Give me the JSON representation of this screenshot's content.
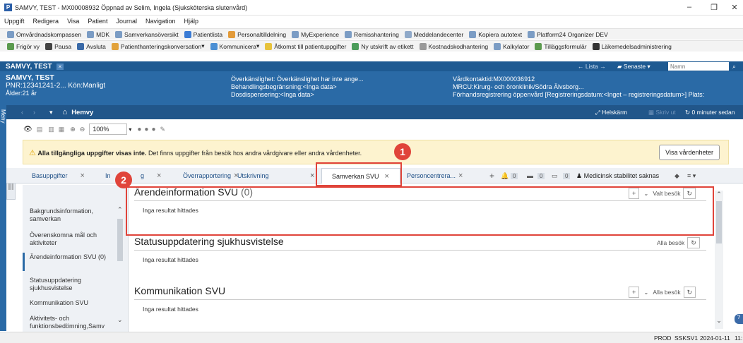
{
  "window": {
    "title": "SAMVY, TEST - MX00008932 Öppnad av Selim, Ingela (Sjuksköterska slutenvård)",
    "app_icon": "P"
  },
  "menu": [
    "Uppgift",
    "Redigera",
    "Visa",
    "Patient",
    "Journal",
    "Navigation",
    "Hjälp"
  ],
  "toolbar1": [
    "Omvårdnadskompassen",
    "MDK",
    "Samverkansöversikt",
    "Patientlista",
    "Personaltilldelning",
    "MyExperience",
    "Remisshantering",
    "Meddelandecenter",
    "Kopiera autotext",
    "Platform24 Organizer DEV"
  ],
  "toolbar2": [
    "Frigör vy",
    "Pausa",
    "Avsluta",
    "Patienthanteringskonversation",
    "Kommunicera",
    "Åtkomst till patientuppgifter",
    "Ny utskrift av etikett",
    "Kostnadskodhantering",
    "Kalkylator",
    "Tilläggsformulär",
    "Läkemedelsadministrering"
  ],
  "patient_bar": {
    "name": "SAMVY, TEST",
    "list_label": "Lista",
    "recent_label": "Senaste",
    "name_placeholder": "Namn"
  },
  "patient_header": {
    "name": "SAMVY, TEST",
    "pnr": "PNR:12341241-2...",
    "gender": "Kön:Manligt",
    "age": "Ålder:21 år",
    "hypersensitivity": "Överkänslighet: Överkänslighet har inte ange...",
    "treatment_limit": "Behandlingsbegränsning:<Inga data>",
    "dose_dispensing": "Dosdispensering:<Inga data>",
    "care_contact": "Vårdkontaktid:MX000036912",
    "mrcu": "MRCU:Kirurg- och öronklinik/Södra Älvsborg...",
    "preregistration": "Förhandsregistrering öppenvård [Registreringsdatum:<Inget – registreringsdatum>] Plats:"
  },
  "nav": {
    "home": "Hemvy",
    "fullscreen": "Helskärm",
    "print": "Skriv ut",
    "refresh": "0 minuter sedan",
    "menu_label": "Meny"
  },
  "zoom": "100%",
  "warning": {
    "bold": "Alla tillgängliga uppgifter visas inte.",
    "text": "Det finns uppgifter från besök hos andra vårdgivare eller andra vårdenheter.",
    "button": "Visa vårdenheter"
  },
  "tabs": [
    {
      "label": "Basuppgifter"
    },
    {
      "label": "In"
    },
    {
      "label": "g"
    },
    {
      "label": "Överrapportering"
    },
    {
      "label": "Utskrivning"
    },
    {
      "label": "Samverkan SVU"
    },
    {
      "label": "Personcentrera..."
    }
  ],
  "tab_badges": [
    "0",
    "0",
    "0",
    "0"
  ],
  "medical_stability": "Medicinsk stabilitet saknas",
  "sidebar": [
    "Bakgrundsinformation, samverkan",
    "Överenskomna mål och aktiviteter",
    "Ärendeinformation SVU (0)",
    "Statusuppdatering sjukhusvistelse",
    "Kommunikation SVU",
    "Aktivitets- och funktionsbedömning,Samv"
  ],
  "sections": [
    {
      "title": "Ärendeinformation SVU",
      "count": "(0)",
      "empty": "Inga resultat hittades",
      "visit": "Valt besök"
    },
    {
      "title": "Statusuppdatering sjukhusvistelse",
      "empty": "Inga resultat hittades",
      "visit": "Alla besök"
    },
    {
      "title": "Kommunikation SVU",
      "empty": "Inga resultat hittades",
      "visit": "Alla besök"
    }
  ],
  "annotations": [
    "1",
    "2"
  ],
  "status": {
    "env": "PROD",
    "server": "SSKSV1",
    "date": "2024-01-11",
    "time": "11:"
  },
  "colors": {
    "accent": "#2a6aa6",
    "annotation": "#e0443a",
    "warning_bg": "#fdf3cf"
  }
}
